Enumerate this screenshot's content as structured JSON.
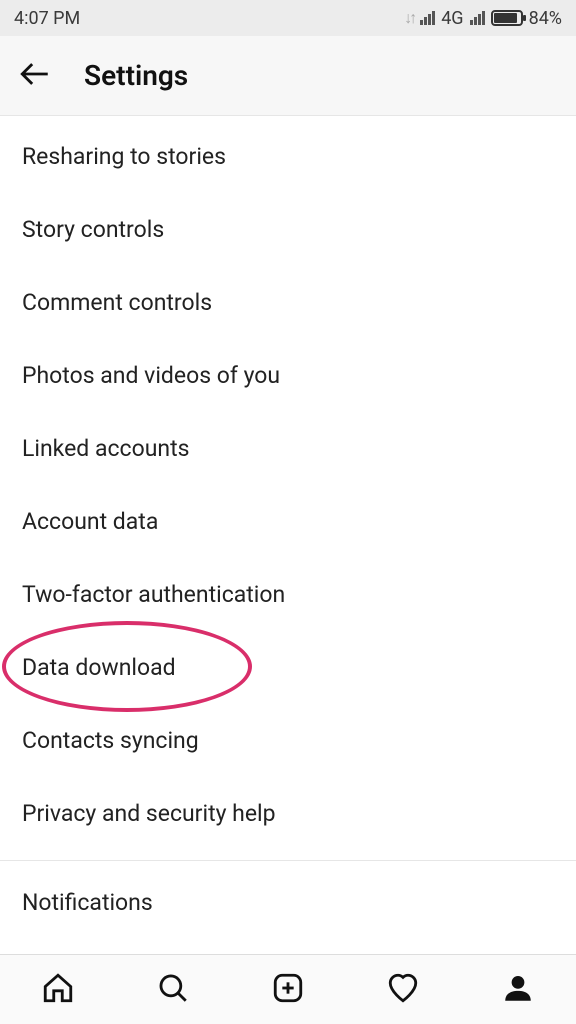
{
  "status": {
    "time": "4:07 PM",
    "network_label": "4G",
    "battery_pct": "84%"
  },
  "header": {
    "title": "Settings"
  },
  "settings_items": [
    "Resharing to stories",
    "Story controls",
    "Comment controls",
    "Photos and videos of you",
    "Linked accounts",
    "Account data",
    "Two-factor authentication",
    "Data download",
    "Contacts syncing",
    "Privacy and security help"
  ],
  "next_section_first": "Notifications",
  "highlight": {
    "item_index": 7,
    "color": "#d92e6a"
  },
  "nav": {
    "items": [
      "home",
      "search",
      "add",
      "activity",
      "profile"
    ],
    "active": "profile"
  }
}
